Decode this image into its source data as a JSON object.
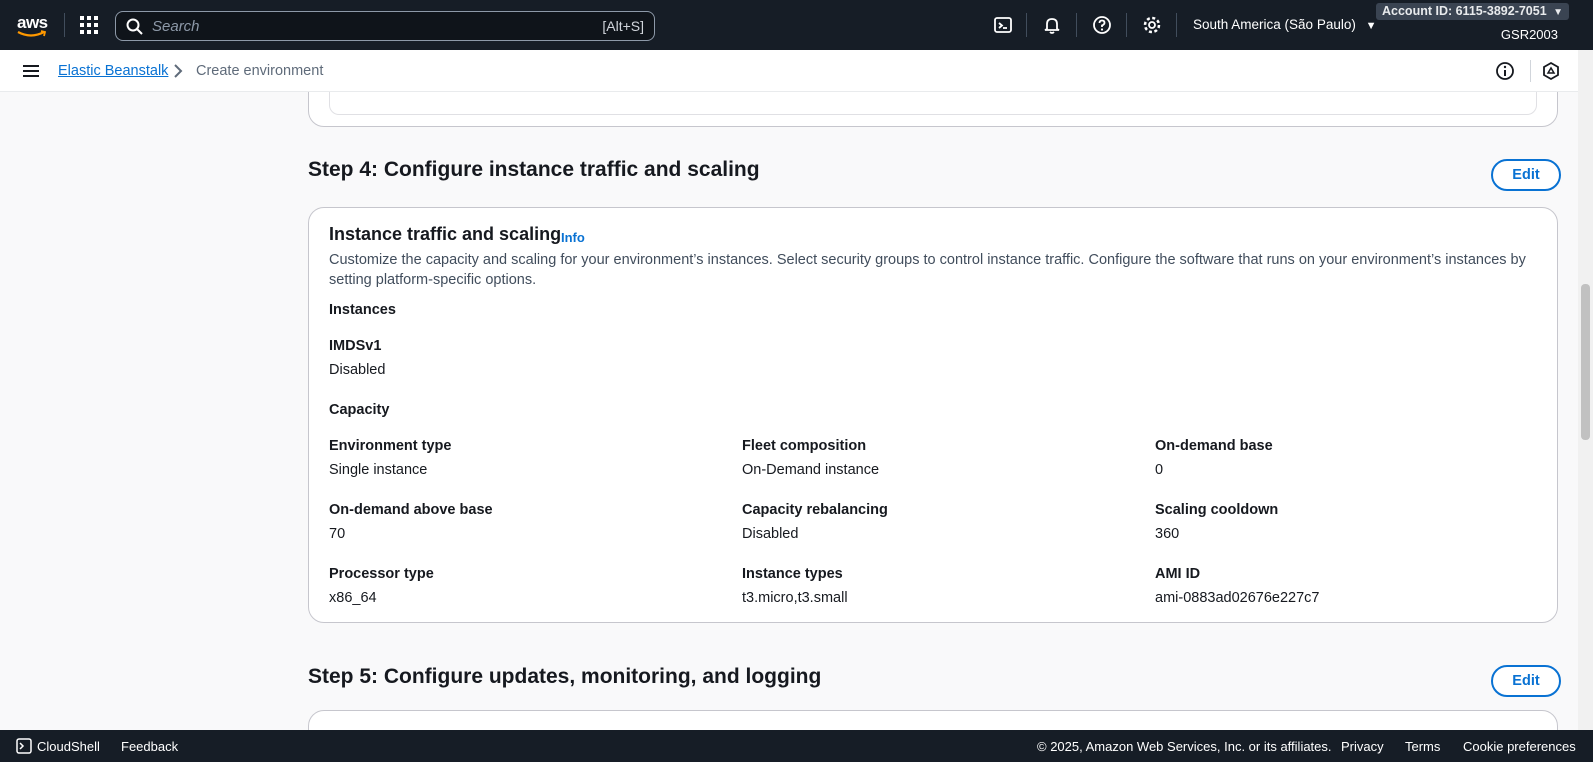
{
  "topnav": {
    "logo_text": "aws",
    "search_placeholder": "Search",
    "search_shortcut": "[Alt+S]",
    "icons": [
      "cloudshell-icon",
      "bell-icon",
      "help-icon",
      "gear-icon"
    ],
    "region": "South America (São Paulo)",
    "account": "Account ID: 6115-3892-7051",
    "user": "GSR2003"
  },
  "breadcrumb": {
    "items": [
      "Elastic Beanstalk",
      "Create environment"
    ]
  },
  "step4": {
    "title": "Step 4: Configure instance traffic and scaling",
    "edit_label": "Edit",
    "card": {
      "title": "Instance traffic and scaling",
      "info": "Info",
      "description": "Customize the capacity and scaling for your environment’s instances. Select security groups to control instance traffic. Configure the software that runs on your environment’s instances by setting platform-specific options.",
      "instances_heading": "Instances",
      "imds_label": "IMDSv1",
      "imds_value": "Disabled",
      "capacity_heading": "Capacity",
      "fields": [
        {
          "label": "Environment type",
          "value": "Single instance"
        },
        {
          "label": "Fleet composition",
          "value": "On-Demand instance"
        },
        {
          "label": "On-demand base",
          "value": "0"
        },
        {
          "label": "On-demand above base",
          "value": "70"
        },
        {
          "label": "Capacity rebalancing",
          "value": "Disabled"
        },
        {
          "label": "Scaling cooldown",
          "value": "360"
        },
        {
          "label": "Processor type",
          "value": "x86_64"
        },
        {
          "label": "Instance types",
          "value": "t3.micro,t3.small"
        },
        {
          "label": "AMI ID",
          "value": "ami-0883ad02676e227c7"
        }
      ]
    }
  },
  "step5": {
    "title": "Step 5: Configure updates, monitoring, and logging",
    "edit_label": "Edit"
  },
  "footer": {
    "cloudshell": "CloudShell",
    "feedback": "Feedback",
    "copyright": "© 2025, Amazon Web Services, Inc. or its affiliates.",
    "privacy": "Privacy",
    "terms": "Terms",
    "cookies": "Cookie preferences"
  }
}
